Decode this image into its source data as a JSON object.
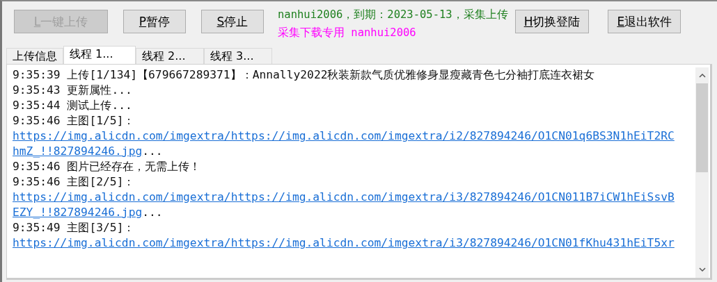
{
  "buttons": [
    {
      "label": "L一键上传",
      "disabled": true
    },
    {
      "label": "P暂停",
      "disabled": false
    },
    {
      "label": "S停止",
      "disabled": false
    }
  ],
  "account_lines": [
    {
      "text": "nanhui2006，到期：2023-05-13，采集上传",
      "color": "#208020"
    },
    {
      "text": "采集下载专用 nanhui2006",
      "color": "#ff00ff"
    }
  ],
  "right_buttons": [
    {
      "label": "H切换登陆",
      "disabled": false
    },
    {
      "label": "E退出软件",
      "disabled": false
    }
  ],
  "tabs": [
    {
      "label": "上传信息",
      "selected": false
    },
    {
      "label": "线程 1...",
      "selected": true
    },
    {
      "label": "线程 2...",
      "selected": false
    },
    {
      "label": "线程 3...",
      "selected": false
    }
  ],
  "log": [
    {
      "kind": "text",
      "text": "9:35:39 上传[1/134]【679667289371】：Annally2022秋装新款气质优雅修身显瘦藏青色七分袖打底连衣裙女"
    },
    {
      "kind": "text",
      "text": "9:35:43 更新属性..."
    },
    {
      "kind": "text",
      "text": "9:35:44 测试上传..."
    },
    {
      "kind": "text",
      "text": "9:35:46 主图[1/5]："
    },
    {
      "kind": "link",
      "url_lines": [
        "https://img.alicdn.com/imgextra/https://img.alicdn.com/imgextra/i2/827894246/O1CN01q6BS3N1hEiT2RC",
        "hmZ_!!827894246.jpg"
      ],
      "suffix": "..."
    },
    {
      "kind": "text",
      "text": "9:35:46 图片已经存在，无需上传！"
    },
    {
      "kind": "text",
      "text": "9:35:46 主图[2/5]："
    },
    {
      "kind": "link",
      "url_lines": [
        "https://img.alicdn.com/imgextra/https://img.alicdn.com/imgextra/i3/827894246/O1CN011B7iCW1hEiSsvB",
        "EZY_!!827894246.jpg"
      ],
      "suffix": "..."
    },
    {
      "kind": "text",
      "text": "9:35:49 主图[3/5]："
    },
    {
      "kind": "link",
      "url_lines": [
        "https://img.alicdn.com/imgextra/https://img.alicdn.com/imgextra/i3/827894246/O1CN01fKhu431hEiT5xr"
      ]
    }
  ]
}
